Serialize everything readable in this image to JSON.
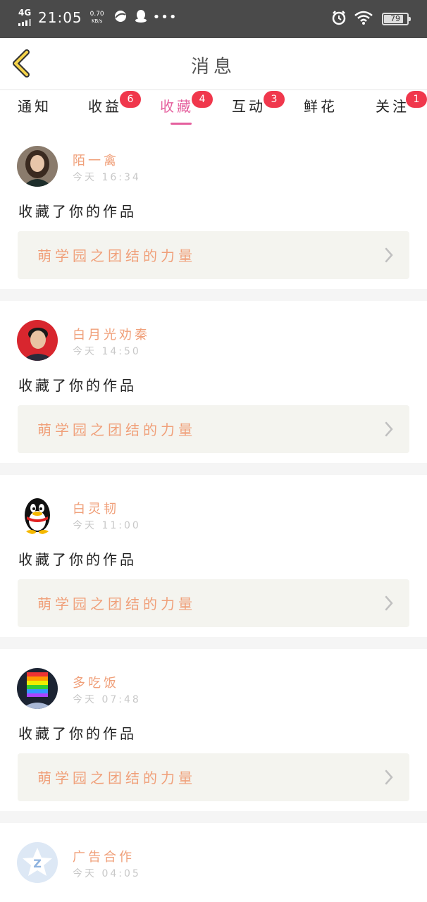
{
  "status_bar": {
    "network": "4G",
    "time": "21:05",
    "speed_value": "0.70",
    "speed_unit": "KB/s",
    "battery": "79",
    "icons": [
      "signal-icon",
      "browser-icon",
      "qq-icon",
      "more-dots-icon",
      "alarm-icon",
      "wifi-icon",
      "battery-icon"
    ]
  },
  "header": {
    "title": "消息",
    "back_icon": "chevron-left-icon",
    "accent": "#f5d34a"
  },
  "tabs": [
    {
      "label": "通知",
      "badge": ""
    },
    {
      "label": "收益",
      "badge": "6"
    },
    {
      "label": "收藏",
      "badge": "4",
      "active": true
    },
    {
      "label": "互动",
      "badge": "3"
    },
    {
      "label": "鲜花",
      "badge": ""
    },
    {
      "label": "关注",
      "badge": "1"
    }
  ],
  "colors": {
    "active_tab": "#e5609e",
    "badge": "#f0374c",
    "username": "#f0a07a",
    "work_bg": "#f4f4ef"
  },
  "messages": [
    {
      "username": "陌一禽",
      "time": "今天 16:34",
      "action": "收藏了你的作品",
      "work_title": "萌学园之团结的力量",
      "avatar": "avatar-woman"
    },
    {
      "username": "白月光劝秦",
      "time": "今天 14:50",
      "action": "收藏了你的作品",
      "work_title": "萌学园之团结的力量",
      "avatar": "avatar-man"
    },
    {
      "username": "白灵韧",
      "time": "今天 11:00",
      "action": "收藏了你的作品",
      "work_title": "萌学园之团结的力量",
      "avatar": "avatar-penguin"
    },
    {
      "username": "多吃饭",
      "time": "今天 07:48",
      "action": "收藏了你的作品",
      "work_title": "萌学园之团结的力量",
      "avatar": "avatar-rainbow"
    },
    {
      "username": "广告合作",
      "time": "今天 04:05",
      "action": "",
      "work_title": "",
      "avatar": "avatar-logo"
    }
  ]
}
